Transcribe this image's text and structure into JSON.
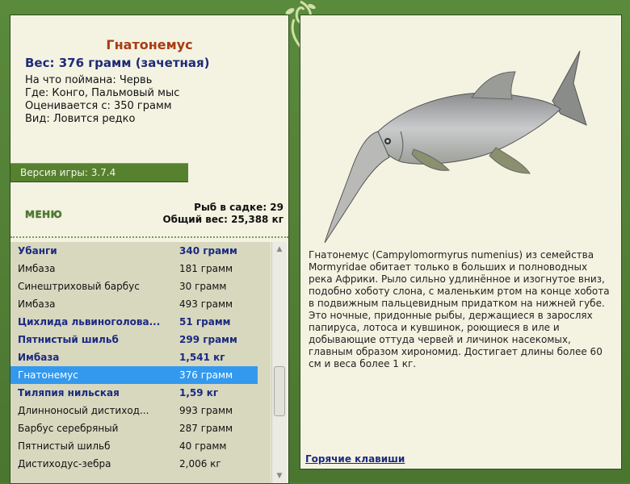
{
  "fish": {
    "title": "Гнатонемус",
    "weight": "Вес: 376 грамм (зачетная)",
    "details": [
      "На что поймана: Червь",
      "Где: Конго, Пальмовый мыс",
      "Оценивается с: 350 грамм",
      "Вид: Ловится редко"
    ]
  },
  "version": "Версия игры: 3.7.4",
  "menu_label": "МЕНЮ",
  "stats": {
    "fish_in_keepnet": "Рыб в садке: 29",
    "total_weight": "Общий вес: 25,388 кг"
  },
  "catch_list": [
    {
      "name": "Убанги",
      "weight": "340 грамм",
      "bold": true
    },
    {
      "name": "Имбаза",
      "weight": "181 грамм",
      "bold": false
    },
    {
      "name": "Синештриховый барбус",
      "weight": "30 грамм",
      "bold": false
    },
    {
      "name": "Имбаза",
      "weight": "493 грамм",
      "bold": false
    },
    {
      "name": "Цихлида львиноголова...",
      "weight": "51 грамм",
      "bold": true
    },
    {
      "name": "Пятнистый шильб",
      "weight": "299 грамм",
      "bold": true
    },
    {
      "name": "Имбаза",
      "weight": "1,541 кг",
      "bold": true
    },
    {
      "name": "Гнатонемус",
      "weight": "376 грамм",
      "bold": false,
      "selected": true
    },
    {
      "name": "Тиляпия нильская",
      "weight": "1,59 кг",
      "bold": true
    },
    {
      "name": "Длинноносый дистиход...",
      "weight": "993 грамм",
      "bold": false
    },
    {
      "name": "Барбус серебряный",
      "weight": "287 грамм",
      "bold": false
    },
    {
      "name": "Пятнистый шильб",
      "weight": "40 грамм",
      "bold": false
    },
    {
      "name": "Дистиходус-зебра",
      "weight": "2,006 кг",
      "bold": false
    }
  ],
  "description": "Гнатонемус (Campylomormyrus numenius) из семейства Mormyridae обитает только в больших и полноводных река Африки. Рыло сильно удлинённое и изогнутое вниз, подобно хоботу слона, с маленьким ртом на конце хобота в подвижным пальцевидным придатком на нижней губе. Это ночные, придонные рыбы, держащиеся в зарослях папируса, лотоса и кувшинок, роющиеся в иле и добывающие оттуда червей и личинок насекомых, главным образом хирономид. Достигает длины более 60 см и веса более 1 кг.",
  "hotkeys_label": "Горячие клавиши",
  "icons": {
    "logo": "fish-leaf-logo-icon",
    "scroll_up": "arrow-up-icon",
    "scroll_down": "arrow-down-icon"
  }
}
